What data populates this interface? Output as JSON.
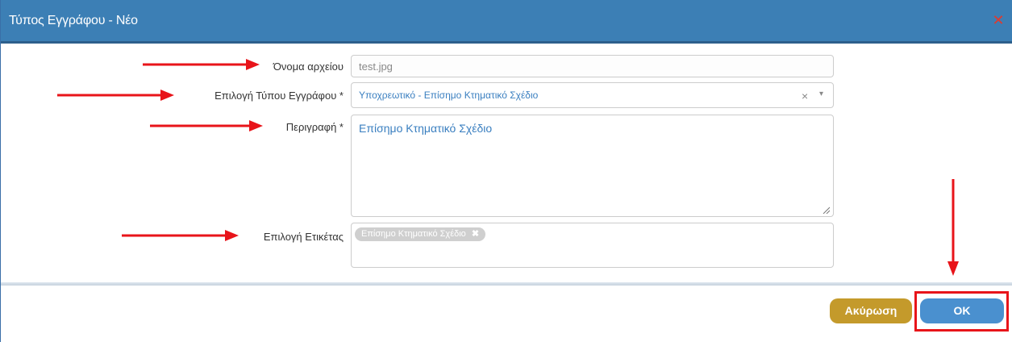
{
  "dialog": {
    "title": "Τύπος Εγγράφου - Νέο",
    "close_glyph": "✕",
    "colors": {
      "title_bg": "#3c7fb5",
      "accent_text": "#3a7fc0",
      "cancel_bg": "#c49a2b",
      "ok_bg": "#4a90cf",
      "annotation_red": "#e8141a"
    }
  },
  "form": {
    "filename": {
      "label": "Όνομα αρχείου",
      "value": "test.jpg"
    },
    "doc_type": {
      "label": "Επιλογή Τύπου Εγγράφου *",
      "value": "Υποχρεωτικό - Επίσημο Κτηματικό Σχέδιο",
      "clear_glyph": "×",
      "dropdown_glyph": "▾"
    },
    "description": {
      "label": "Περιγραφή *",
      "value": "Επίσημο Κτηματικό Σχέδιο"
    },
    "tags": {
      "label": "Επιλογή Ετικέτας",
      "selected": [
        {
          "label": "Επίσημο Κτηματικό Σχέδιο",
          "remove_glyph": "✖"
        }
      ]
    }
  },
  "footer": {
    "cancel_label": "Ακύρωση",
    "ok_label": "OK"
  }
}
